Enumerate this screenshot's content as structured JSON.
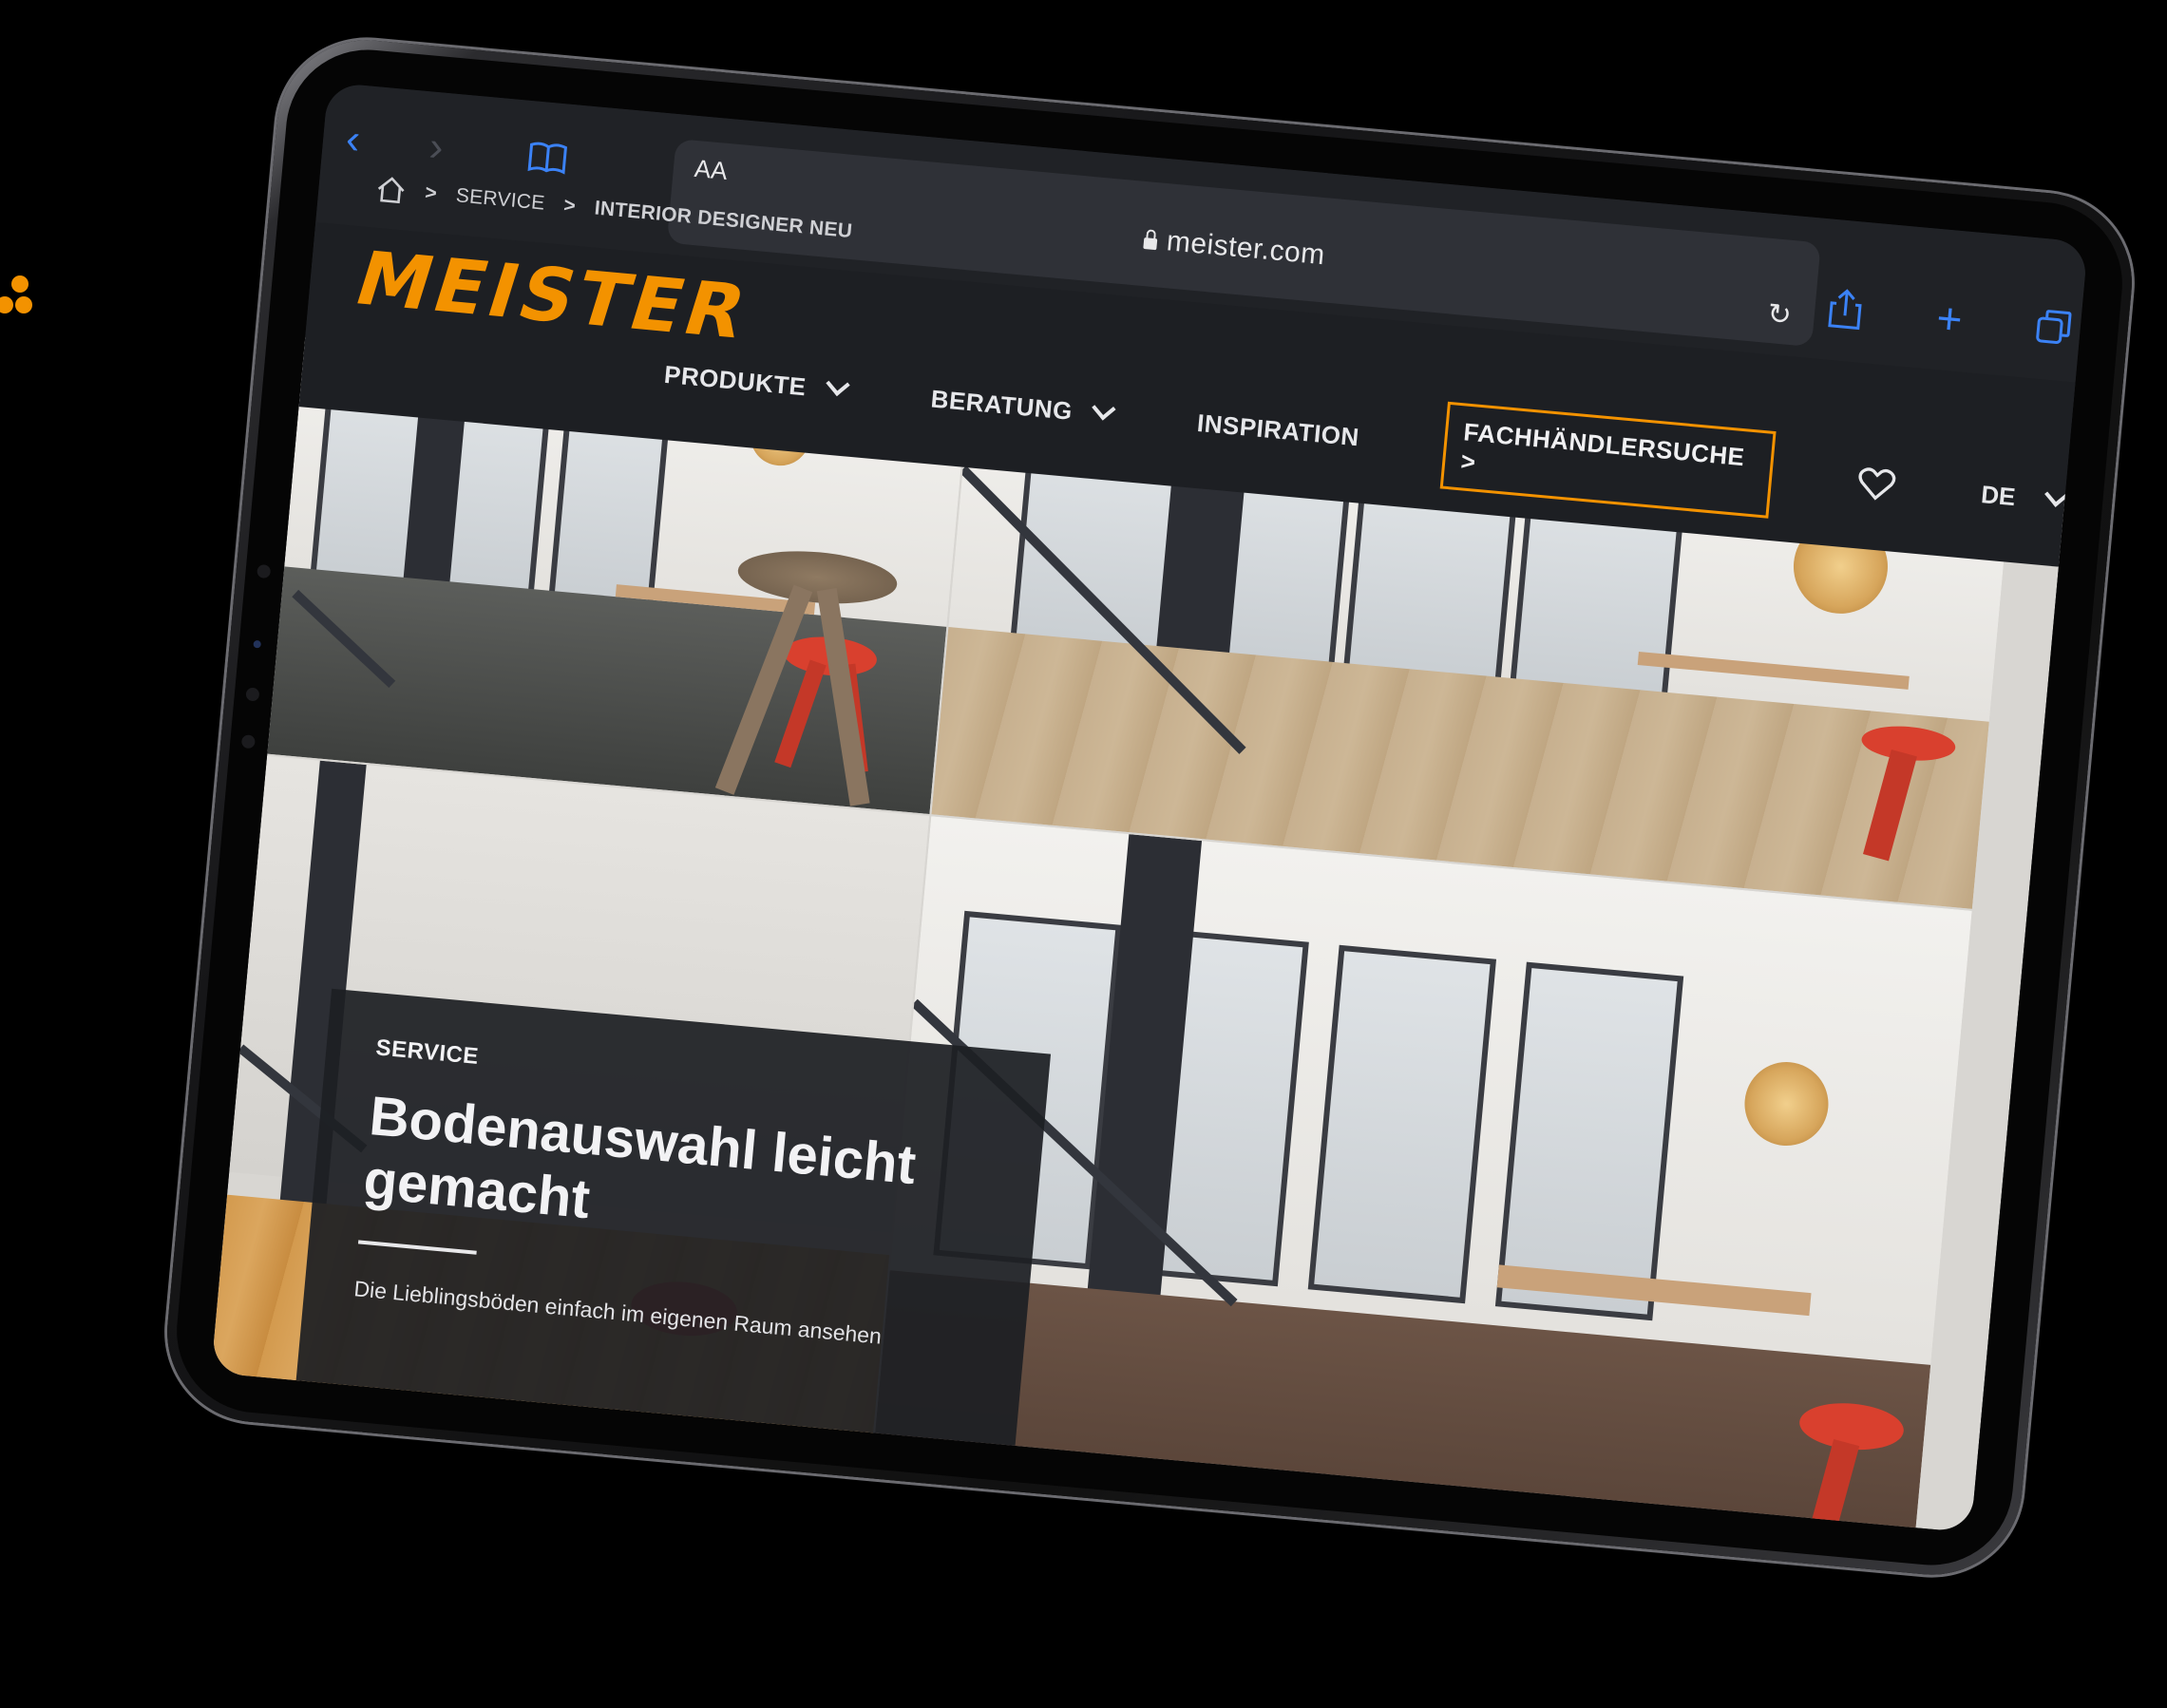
{
  "browser": {
    "reader_label": "AA",
    "url": "meister.com",
    "back_icon": "chevron-left-icon",
    "forward_icon": "chevron-right-icon",
    "toolbar_icons": [
      "share-icon",
      "new-tab-plus-icon",
      "tabs-overview-icon"
    ],
    "accent_color": "#3b82f6"
  },
  "breadcrumb": {
    "items": [
      "SERVICE",
      "INTERIOR DESIGNER NEU"
    ],
    "separator": ">"
  },
  "header": {
    "brand": "MEISTER",
    "brand_color": "#f39200",
    "nav": [
      {
        "label": "PRODUKTE"
      },
      {
        "label": "BERATUNG"
      },
      {
        "label": "INSPIRATION"
      }
    ],
    "dealer_button": "FACHHÄNDLERSUCHE >",
    "language": "DE"
  },
  "hero": {
    "kicker": "SERVICE",
    "title_line1": "Bodenauswahl leicht",
    "title_line2": "gemacht",
    "text": "Die Lieblingsböden einfach im eigenen Raum ansehen"
  }
}
